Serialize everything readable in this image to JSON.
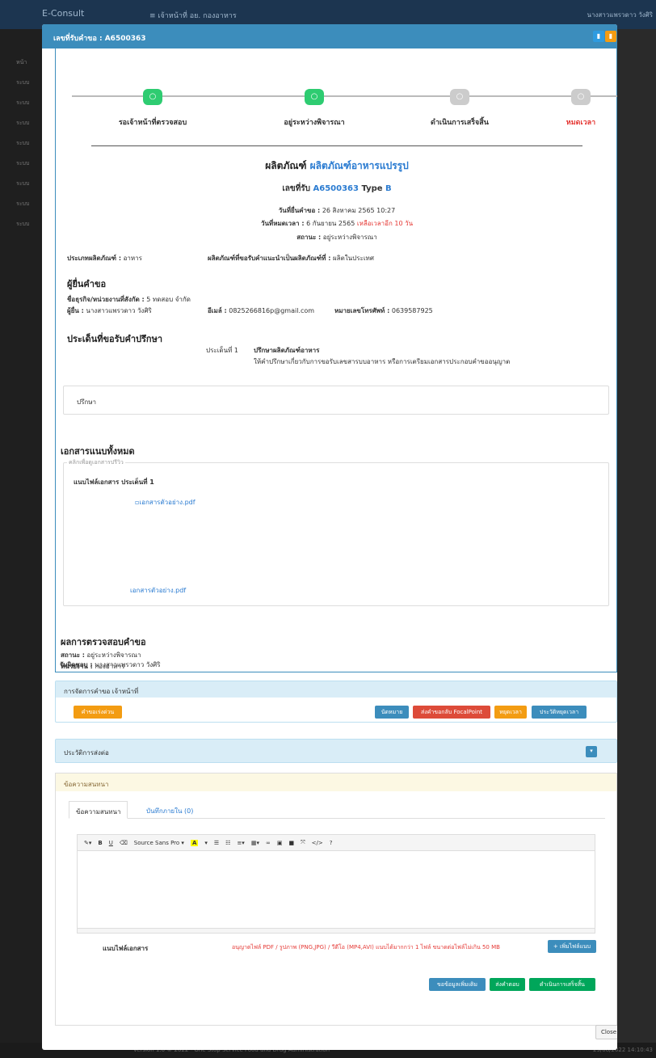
{
  "app": {
    "brand": "E-Consult",
    "menu": "≡ เจ้าหน้าที่ อย. กองอาหาร",
    "user": "นางสาวแพรวดาว วังศิริ",
    "footer_left": "Version 1.0 © 2022 - One Stop Service Food and Drug Administration",
    "footer_right": "29/08/2022 14:10:43",
    "sidebar": [
      "หน้า",
      "ระบบ",
      "ระบบ",
      "ระบบ",
      "ระบบ",
      "ระบบ",
      "ระบบ",
      "ระบบ",
      "ระบบ"
    ]
  },
  "modal": {
    "title": "เลขที่รับคำขอ : A6500363",
    "close": "Close"
  },
  "steps": [
    {
      "label": "รอเจ้าหน้าที่ตรวจสอบ",
      "state": "done",
      "color": "#2ecc71"
    },
    {
      "label": "อยู่ระหว่างพิจารณา",
      "state": "done",
      "color": "#2ecc71"
    },
    {
      "label": "ดำเนินการเสร็จสิ้น",
      "state": "pending",
      "color": "#cccccc"
    },
    {
      "label": "หมดเวลา",
      "state": "pending",
      "color": "#cccccc"
    }
  ],
  "product": {
    "prefix": "ผลิตภัณฑ์",
    "name": "ผลิตภัณฑ์อาหารแปรรูป",
    "receipt_label": "เลขที่รับ",
    "receipt_no": "A6500363",
    "type_label": "Type",
    "type": "B",
    "submit_label": "วันที่ยื่นคำขอ :",
    "submit_date": "26 สิงหาคม 2565 10:27",
    "expire_label": "วันที่หมดเวลา :",
    "expire_date": "6 กันยายน 2565",
    "remaining": "เหลือเวลาอีก 10 วัน",
    "status_label": "สถานะ :",
    "status": "อยู่ระหว่างพิจารณา",
    "cat_label": "ประเภทผลิตภัณฑ์ :",
    "cat": "อาหาร",
    "origin_label": "ผลิตภัณฑ์ที่ขอรับคำแนะนำเป็นผลิตภัณฑ์ที่ :",
    "origin": "ผลิตในประเทศ"
  },
  "applicant": {
    "heading": "ผู้ยื่นคำขอ",
    "org_label": "ชื่อธุรกิจ/หน่วยงานที่สังกัด :",
    "org": "5 ทดสอบ จำกัด",
    "name_label": "ผู้ยื่น :",
    "name": "นางสาวแพรวดาว วังศิริ",
    "email_label": "อีเมล์ :",
    "email": "0825266816p@gmail.com",
    "phone_label": "หมายเลขโทรศัพท์ :",
    "phone": "0639587925"
  },
  "issues": {
    "heading": "ประเด็นที่ขอรับคำปรึกษา",
    "item_label": "ประเด็นที่ 1",
    "item_title": "ปรึกษาผลิตภัณฑ์อาหาร",
    "item_desc": "ให้คำปรึกษาเกี่ยวกับการขอรับเลขสารบบอาหาร หรือการเตรียมเอกสารประกอบคำขออนุญาต",
    "note": "ปรึกษา"
  },
  "attachments": {
    "heading": "เอกสารแนบทั้งหมด",
    "hint": "คลิกเพื่อดูเอกสารปรีวิว",
    "group": "แนบไฟล์เอกสาร ประเด็นที่ 1",
    "img_alt": "เอกสารตัวอย่าง.pdf",
    "link": "เอกสารตัวอย่าง.pdf"
  },
  "result": {
    "heading": "ผลการตรวจสอบคำขอ",
    "status_label": "สถานะ :",
    "status": "อยู่ระหว่างพิจารณา",
    "unit_label": "หน่วยงาน :",
    "unit": "กองอาหาร",
    "owner_label": "รับผิดชอบ :",
    "owner": "นางสาวแพรวดาว วังศิริ"
  },
  "manage": {
    "title": "การจัดการคำขอ เจ้าหน้าที่",
    "urgent": "คำขอเร่งด่วน",
    "appoint": "นัดหมาย",
    "return_fp": "ส่งคำขอกลับ FocalPoint",
    "pause": "หยุดเวลา",
    "pause_hist": "ประวัติหยุดเวลา"
  },
  "forward": {
    "title": "ประวัติการส่งต่อ"
  },
  "chat": {
    "title": "ข้อความสนทนา",
    "tab1": "ข้อความสนทนา",
    "tab2": "บันทึกภายใน (0)",
    "font": "Source Sans Pro",
    "attach_label": "แนบไฟล์เอกสาร",
    "allowed": "อนุญาตไฟล์ PDF / รูปภาพ (PNG,JPG) / วีดีโอ (MP4,AVI) แนบได้มากกว่า 1 ไฟล์ ขนาดต่อไฟล์ไม่เกิน 50 MB",
    "add_file": "+ เพิ่มไฟล์แนบ",
    "more_info": "ขอข้อมูลเพิ่มเติม",
    "reply": "ส่งคำตอบ",
    "finish": "ดำเนินการเสร็จสิ้น"
  }
}
